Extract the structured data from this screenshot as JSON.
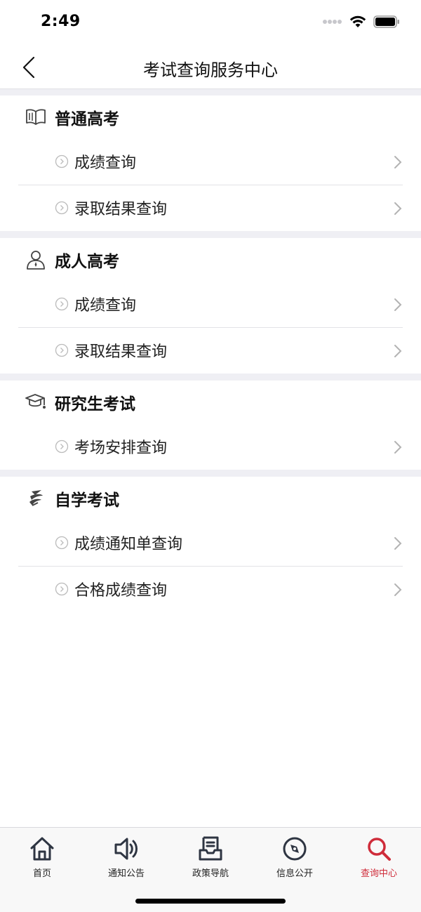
{
  "status_bar": {
    "time": "2:49"
  },
  "nav": {
    "title": "考试查询服务中心"
  },
  "sections": [
    {
      "title": "普通高考",
      "icon": "open-book-icon",
      "items": [
        {
          "label": "成绩查询"
        },
        {
          "label": "录取结果查询"
        }
      ]
    },
    {
      "title": "成人高考",
      "icon": "person-icon",
      "items": [
        {
          "label": "成绩查询"
        },
        {
          "label": "录取结果查询"
        }
      ]
    },
    {
      "title": "研究生考试",
      "icon": "graduation-cap-icon",
      "items": [
        {
          "label": "考场安排查询"
        }
      ]
    },
    {
      "title": "自学考试",
      "icon": "self-study-logo-icon",
      "items": [
        {
          "label": "成绩通知单查询"
        },
        {
          "label": "合格成绩查询"
        }
      ]
    }
  ],
  "tab_bar": {
    "active_color": "#cf2c3a",
    "tabs": [
      {
        "label": "首页",
        "icon": "home-icon",
        "active": false
      },
      {
        "label": "通知公告",
        "icon": "speaker-icon",
        "active": false
      },
      {
        "label": "政策导航",
        "icon": "document-tray-icon",
        "active": false
      },
      {
        "label": "信息公开",
        "icon": "compass-icon",
        "active": false
      },
      {
        "label": "查询中心",
        "icon": "search-icon",
        "active": true
      }
    ]
  }
}
